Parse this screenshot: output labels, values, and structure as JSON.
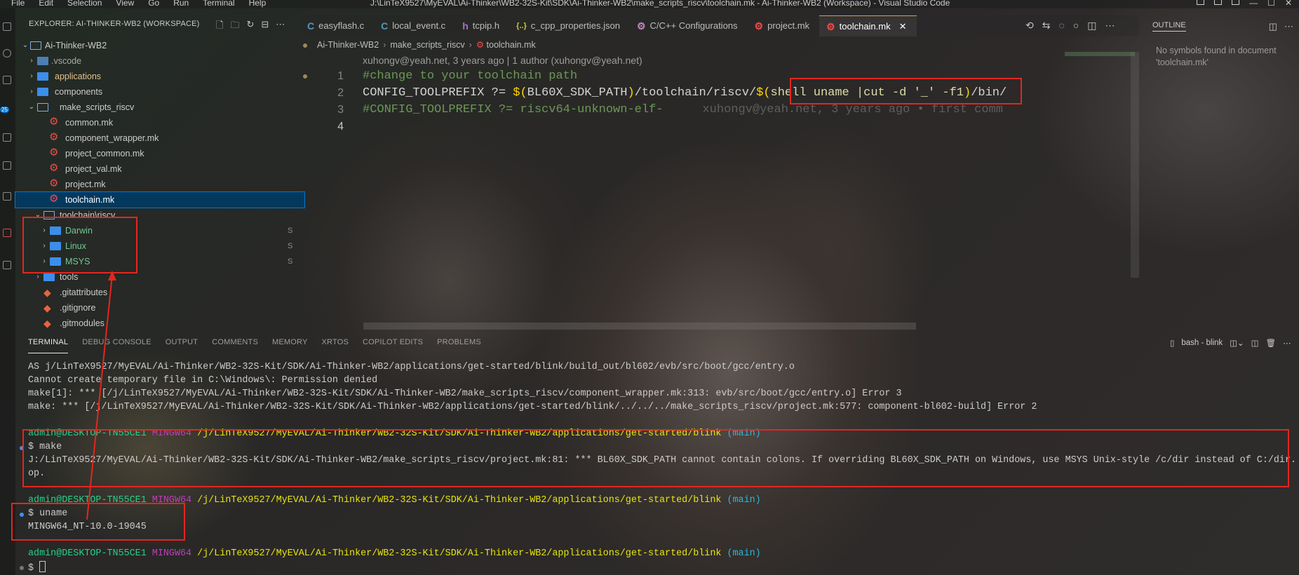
{
  "titlebar": {
    "menu": [
      "File",
      "Edit",
      "Selection",
      "View",
      "Go",
      "Run",
      "Terminal",
      "Help"
    ],
    "title": "J:\\LinTeX9527\\MyEVAL\\Ai-Thinker\\WB2-32S-Kit\\SDK\\Ai-Thinker-WB2\\make_scripts_riscv\\toolchain.mk - Ai-Thinker-WB2 (Workspace) - Visual Studio Code"
  },
  "activity": {
    "badge": "25"
  },
  "explorer": {
    "header": "EXPLORER: AI-THINKER-WB2 (WORKSPACE)",
    "items": [
      {
        "label": "Ai-Thinker-WB2",
        "status": ""
      },
      {
        "label": ".vscode",
        "status": ""
      },
      {
        "label": "applications",
        "status": ""
      },
      {
        "label": "components",
        "status": ""
      },
      {
        "label": "make_scripts_riscv",
        "status": ""
      },
      {
        "label": "common.mk",
        "status": ""
      },
      {
        "label": "component_wrapper.mk",
        "status": ""
      },
      {
        "label": "project_common.mk",
        "status": ""
      },
      {
        "label": "project_val.mk",
        "status": ""
      },
      {
        "label": "project.mk",
        "status": ""
      },
      {
        "label": "toolchain.mk",
        "status": ""
      },
      {
        "label": "toolchain\\riscv",
        "status": ""
      },
      {
        "label": "Darwin",
        "status": "S"
      },
      {
        "label": "Linux",
        "status": "S"
      },
      {
        "label": "MSYS",
        "status": "S"
      },
      {
        "label": "tools",
        "status": ""
      },
      {
        "label": ".gitattributes",
        "status": ""
      },
      {
        "label": ".gitignore",
        "status": ""
      },
      {
        "label": ".gitmodules",
        "status": ""
      }
    ]
  },
  "tabs": [
    {
      "label": "easyflash.c",
      "icon": "C"
    },
    {
      "label": "local_event.c",
      "icon": "C"
    },
    {
      "label": "tcpip.h",
      "icon": "h"
    },
    {
      "label": "c_cpp_properties.json",
      "icon": "{..}"
    },
    {
      "label": "C/C++ Configurations",
      "icon": "gear"
    },
    {
      "label": "project.mk",
      "icon": "gear"
    },
    {
      "label": "toolchain.mk",
      "icon": "gear"
    }
  ],
  "breadcrumb": [
    "Ai-Thinker-WB2",
    "make_scripts_riscv",
    "toolchain.mk"
  ],
  "codelens": "xuhongv@yeah.net, 3 years ago | 1 author (xuhongv@yeah.net)",
  "editor": {
    "line_numbers": [
      "1",
      "2",
      "3",
      "4"
    ],
    "line1": "#change to your toolchain path",
    "line2": {
      "a": "CONFIG_TOOLPREFIX ?= ",
      "b1": "$(",
      "c": "BL60X_SDK_PATH",
      "b2": ")",
      "d": "/toolchain/riscv/",
      "b3": "$(",
      "e": "shell uname |cut -d '_' -f1",
      "b4": ")",
      "f": "/bin/"
    },
    "line3": {
      "code": "#CONFIG_TOOLPREFIX ?= riscv64-unknown-elf-",
      "blame": "xuhongv@yeah.net, 3 years ago • first comm"
    }
  },
  "outline": {
    "title": "OUTLINE",
    "empty": "No symbols found in document 'toolchain.mk'"
  },
  "panel": {
    "tabs": [
      "TERMINAL",
      "DEBUG CONSOLE",
      "OUTPUT",
      "COMMENTS",
      "MEMORY",
      "XRTOS",
      "COPILOT EDITS",
      "PROBLEMS"
    ],
    "shell": "bash - blink"
  },
  "terminal": {
    "l1": "AS j/LinTeX9527/MyEVAL/Ai-Thinker/WB2-32S-Kit/SDK/Ai-Thinker-WB2/applications/get-started/blink/build_out/bl602/evb/src/boot/gcc/entry.o",
    "l2": "Cannot create temporary file in C:\\Windows\\: Permission denied",
    "l3": "make[1]: *** [/j/LinTeX9527/MyEVAL/Ai-Thinker/WB2-32S-Kit/SDK/Ai-Thinker-WB2/make_scripts_riscv/component_wrapper.mk:313: evb/src/boot/gcc/entry.o] Error 3",
    "l4": "make: *** [/j/LinTeX9527/MyEVAL/Ai-Thinker/WB2-32S-Kit/SDK/Ai-Thinker-WB2/applications/get-started/blink/../../../make_scripts_riscv/project.mk:577: component-bl602-build] Error 2",
    "user": "admin@DESKTOP-TN55CE1",
    "host": "MINGW64",
    "path": "/j/LinTeX9527/MyEVAL/Ai-Thinker/WB2-32S-Kit/SDK/Ai-Thinker-WB2/applications/get-started/blink",
    "branch": "(main)",
    "cmd1": "$ make",
    "out1a": "J:/LinTeX9527/MyEVAL/Ai-Thinker/WB2-32S-Kit/SDK/Ai-Thinker-WB2/make_scripts_riscv/project.mk:81: *** BL60X_SDK_PATH cannot contain colons. If overriding BL60X_SDK_PATH on Windows, use MSYS Unix-style /c/dir instead of C:/dir.",
    "out1b": "op.",
    "cmd2": "$ uname",
    "out2": "MINGW64_NT-10.0-19045",
    "prompt": "$ "
  },
  "colors": {
    "accent": "#0078d4",
    "annotation": "#e3261f",
    "comment": "#6a9955"
  }
}
